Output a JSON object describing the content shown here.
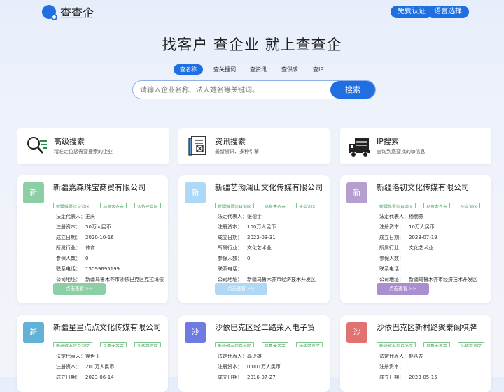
{
  "header": {
    "logo_text": "查查企",
    "buttons": [
      "免费认证",
      "语言选择"
    ]
  },
  "hero": {
    "title": "找客户 查企业 就上查查企",
    "tabs": [
      "查名称",
      "查关键词",
      "查资讯",
      "查供求",
      "查IP"
    ],
    "active_tab": 0
  },
  "search": {
    "placeholder": "请输入企业名称、法人姓名等关键词。",
    "button": "搜索"
  },
  "features": [
    {
      "icon": "magnifier-list-icon",
      "title": "高级搜索",
      "desc": "精准定位您需要搜索的企业"
    },
    {
      "icon": "document-icon",
      "title": "资讯搜索",
      "desc": "最新资讯、多种引擎"
    },
    {
      "icon": "truck-icon",
      "title": "IP搜索",
      "desc": "查询到您要找的ip信息"
    }
  ],
  "field_labels": [
    "法定代表人：",
    "注册资本：",
    "成立日期：",
    "所属行业：",
    "参保人数：",
    "联系电话：",
    "公司地址："
  ],
  "more_label": "点击查看 >>",
  "companies": [
    {
      "avatar": "新",
      "color": "#8ccfa5",
      "btn_color": "#8ccfa5",
      "name": "新疆嘉森珠宝商贸有限公司",
      "tags": [
        "新疆维吾尔自治区",
        "乌鲁木齐市",
        "沙依巴克区"
      ],
      "values": [
        "王庆",
        "50万人民币",
        "2020-10-16",
        "体育",
        "0",
        "15099695199",
        "新疆乌鲁木齐市沙依巴克区克拉玛依"
      ]
    },
    {
      "avatar": "新",
      "color": "#aed8f5",
      "btn_color": "#aed8f5",
      "name": "新疆艺渤澜山文化传媒有限公司",
      "tags": [
        "新疆维吾尔自治区",
        "乌鲁木齐市",
        "头屯河区"
      ],
      "values": [
        "张德宇",
        "100万人民币",
        "2022-03-31",
        "文化艺术业",
        "0",
        "",
        "新疆乌鲁木齐市经济技术开发区"
      ]
    },
    {
      "avatar": "新",
      "color": "#b49fce",
      "btn_color": "#ab8ed0",
      "name": "新疆洛初文化传媒有限公司",
      "tags": [
        "新疆维吾尔自治区",
        "乌鲁木齐市",
        "头屯河区"
      ],
      "values": [
        "杨丽芬",
        "10万人民币",
        "2023-07-19",
        "文化艺术业",
        "",
        "",
        "新疆乌鲁木齐市经济技术开发区"
      ]
    },
    {
      "avatar": "新",
      "color": "#62b1d6",
      "btn_color": "#62b1d6",
      "name": "新疆星星点点文化传媒有限公司",
      "tags": [
        "新疆维吾尔自治区",
        "乌鲁木齐市",
        "沙依巴克区"
      ],
      "values": [
        "徐世玉",
        "200万人民币",
        "2023-06-14"
      ]
    },
    {
      "avatar": "沙",
      "color": "#6f7be0",
      "btn_color": "#6f7be0",
      "name": "沙依巴克区经二路荣大电子贸",
      "tags": [
        "新疆维吾尔自治区",
        "乌鲁木齐市",
        "沙依巴克区"
      ],
      "values": [
        "高少雄",
        "0.001万人民币",
        "2016-07-27"
      ]
    },
    {
      "avatar": "沙",
      "color": "#e27272",
      "btn_color": "#e27272",
      "name": "沙依巴克区新村路聚泰阚棋牌",
      "tags": [
        "新疆维吾尔自治区",
        "乌鲁木齐市",
        "沙依巴克区"
      ],
      "values": [
        "赵从友",
        "",
        "2023-05-15"
      ]
    }
  ]
}
